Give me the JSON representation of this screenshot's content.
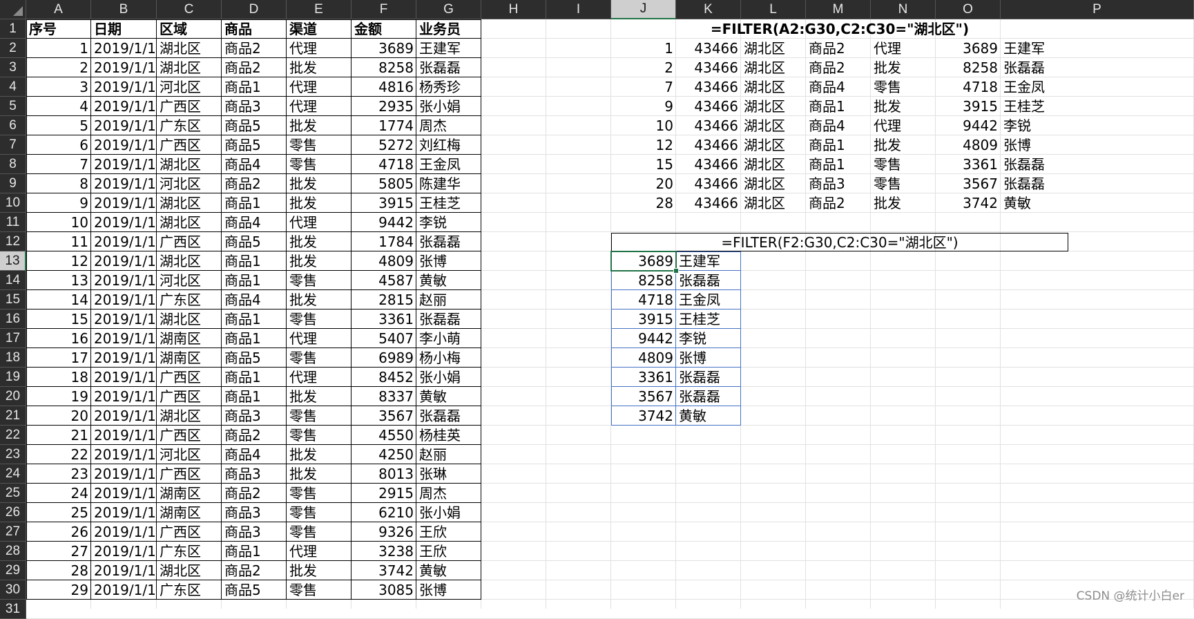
{
  "sheet": {
    "columns": [
      "A",
      "B",
      "C",
      "D",
      "E",
      "F",
      "G",
      "H",
      "I",
      "J",
      "K",
      "L",
      "M",
      "N",
      "O",
      "P"
    ],
    "rows": [
      "1",
      "2",
      "3",
      "4",
      "5",
      "6",
      "7",
      "8",
      "9",
      "10",
      "11",
      "12",
      "13",
      "14",
      "15",
      "16",
      "17",
      "18",
      "19",
      "20",
      "21",
      "22",
      "23",
      "24",
      "25",
      "26",
      "27",
      "28",
      "29",
      "30",
      "31"
    ],
    "selected_column": "J",
    "selected_row": "13"
  },
  "source_table": {
    "headers": [
      "序号",
      "日期",
      "区域",
      "商品",
      "渠道",
      "金额",
      "业务员"
    ],
    "rows": [
      [
        "1",
        "2019/1/1",
        "湖北区",
        "商品2",
        "代理",
        "3689",
        "王建军"
      ],
      [
        "2",
        "2019/1/1",
        "湖北区",
        "商品2",
        "批发",
        "8258",
        "张磊磊"
      ],
      [
        "3",
        "2019/1/1",
        "河北区",
        "商品1",
        "代理",
        "4816",
        "杨秀珍"
      ],
      [
        "4",
        "2019/1/1",
        "广西区",
        "商品3",
        "代理",
        "2935",
        "张小娟"
      ],
      [
        "5",
        "2019/1/1",
        "广东区",
        "商品5",
        "批发",
        "1774",
        "周杰"
      ],
      [
        "6",
        "2019/1/1",
        "广西区",
        "商品5",
        "零售",
        "5272",
        "刘红梅"
      ],
      [
        "7",
        "2019/1/1",
        "湖北区",
        "商品4",
        "零售",
        "4718",
        "王金凤"
      ],
      [
        "8",
        "2019/1/1",
        "河北区",
        "商品2",
        "批发",
        "5805",
        "陈建华"
      ],
      [
        "9",
        "2019/1/1",
        "湖北区",
        "商品1",
        "批发",
        "3915",
        "王桂芝"
      ],
      [
        "10",
        "2019/1/1",
        "湖北区",
        "商品4",
        "代理",
        "9442",
        "李锐"
      ],
      [
        "11",
        "2019/1/1",
        "广西区",
        "商品5",
        "批发",
        "1784",
        "张磊磊"
      ],
      [
        "12",
        "2019/1/1",
        "湖北区",
        "商品1",
        "批发",
        "4809",
        "张博"
      ],
      [
        "13",
        "2019/1/1",
        "河北区",
        "商品1",
        "零售",
        "4587",
        "黄敏"
      ],
      [
        "14",
        "2019/1/1",
        "广东区",
        "商品4",
        "批发",
        "2815",
        "赵丽"
      ],
      [
        "15",
        "2019/1/1",
        "湖北区",
        "商品1",
        "零售",
        "3361",
        "张磊磊"
      ],
      [
        "16",
        "2019/1/1",
        "湖南区",
        "商品1",
        "代理",
        "5407",
        "李小萌"
      ],
      [
        "17",
        "2019/1/1",
        "湖南区",
        "商品5",
        "零售",
        "6989",
        "杨小梅"
      ],
      [
        "18",
        "2019/1/1",
        "广西区",
        "商品1",
        "代理",
        "8452",
        "张小娟"
      ],
      [
        "19",
        "2019/1/1",
        "广西区",
        "商品1",
        "批发",
        "8337",
        "黄敏"
      ],
      [
        "20",
        "2019/1/1",
        "湖北区",
        "商品3",
        "零售",
        "3567",
        "张磊磊"
      ],
      [
        "21",
        "2019/1/1",
        "广西区",
        "商品2",
        "零售",
        "4550",
        "杨桂英"
      ],
      [
        "22",
        "2019/1/1",
        "河北区",
        "商品4",
        "批发",
        "4250",
        "赵丽"
      ],
      [
        "23",
        "2019/1/1",
        "广西区",
        "商品3",
        "批发",
        "8013",
        "张琳"
      ],
      [
        "24",
        "2019/1/1",
        "湖南区",
        "商品2",
        "零售",
        "2915",
        "周杰"
      ],
      [
        "25",
        "2019/1/1",
        "湖南区",
        "商品3",
        "零售",
        "6210",
        "张小娟"
      ],
      [
        "26",
        "2019/1/1",
        "广西区",
        "商品3",
        "零售",
        "9326",
        "王欣"
      ],
      [
        "27",
        "2019/1/1",
        "广东区",
        "商品1",
        "代理",
        "3238",
        "王欣"
      ],
      [
        "28",
        "2019/1/1",
        "湖北区",
        "商品2",
        "批发",
        "3742",
        "黄敏"
      ],
      [
        "29",
        "2019/1/1",
        "广东区",
        "商品5",
        "零售",
        "3085",
        "张博"
      ]
    ]
  },
  "filter1": {
    "formula": "=FILTER(A2:G30,C2:C30=\"湖北区\")",
    "rows": [
      [
        "1",
        "43466",
        "湖北区",
        "商品2",
        "代理",
        "3689",
        "王建军"
      ],
      [
        "2",
        "43466",
        "湖北区",
        "商品2",
        "批发",
        "8258",
        "张磊磊"
      ],
      [
        "7",
        "43466",
        "湖北区",
        "商品4",
        "零售",
        "4718",
        "王金凤"
      ],
      [
        "9",
        "43466",
        "湖北区",
        "商品1",
        "批发",
        "3915",
        "王桂芝"
      ],
      [
        "10",
        "43466",
        "湖北区",
        "商品4",
        "代理",
        "9442",
        "李锐"
      ],
      [
        "12",
        "43466",
        "湖北区",
        "商品1",
        "批发",
        "4809",
        "张博"
      ],
      [
        "15",
        "43466",
        "湖北区",
        "商品1",
        "零售",
        "3361",
        "张磊磊"
      ],
      [
        "20",
        "43466",
        "湖北区",
        "商品3",
        "零售",
        "3567",
        "张磊磊"
      ],
      [
        "28",
        "43466",
        "湖北区",
        "商品2",
        "批发",
        "3742",
        "黄敏"
      ]
    ]
  },
  "filter2": {
    "formula": "=FILTER(F2:G30,C2:C30=\"湖北区\")",
    "rows": [
      [
        "3689",
        "王建军"
      ],
      [
        "8258",
        "张磊磊"
      ],
      [
        "4718",
        "王金凤"
      ],
      [
        "3915",
        "王桂芝"
      ],
      [
        "9442",
        "李锐"
      ],
      [
        "4809",
        "张博"
      ],
      [
        "3361",
        "张磊磊"
      ],
      [
        "3567",
        "张磊磊"
      ],
      [
        "3742",
        "黄敏"
      ]
    ]
  },
  "watermark": "CSDN @统计小白er",
  "colors": {
    "header_bg": "#2d2d2d",
    "header_text": "#e6e6e6",
    "selection": "#217346",
    "spill_border": "#4472c4",
    "gridline": "#e1e1e1"
  }
}
